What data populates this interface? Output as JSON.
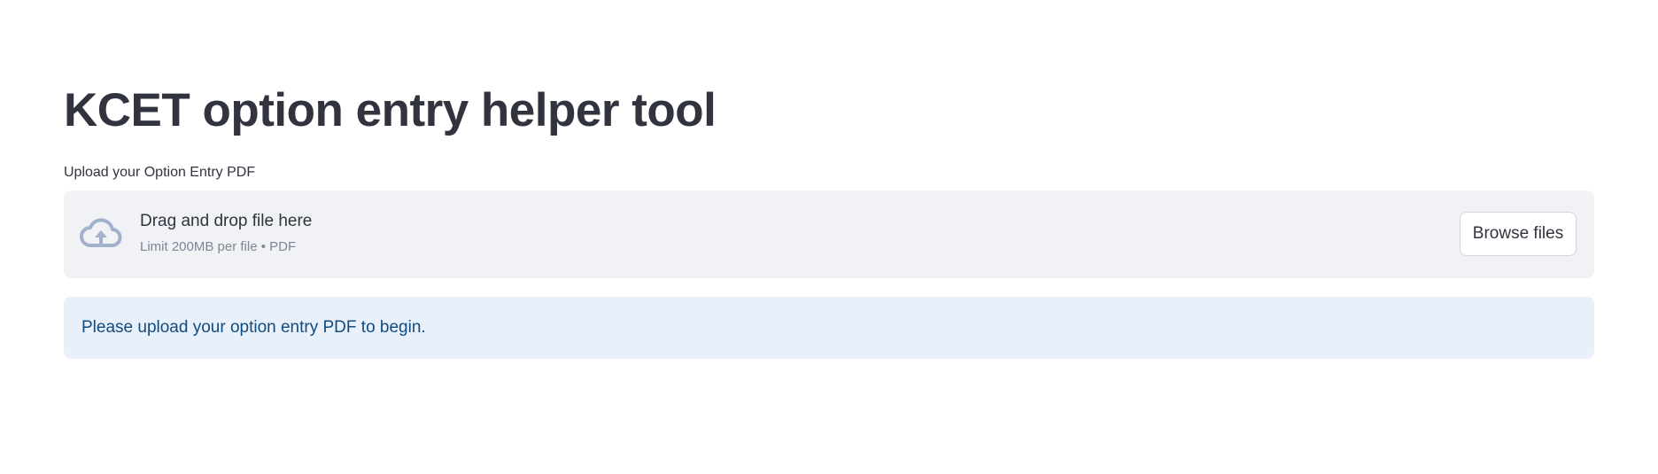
{
  "page": {
    "title": "KCET option entry helper tool"
  },
  "uploader": {
    "label": "Upload your Option Entry PDF",
    "dropzone_instructions": "Drag and drop file here",
    "limit_text": "Limit 200MB per file • PDF",
    "browse_label": "Browse files",
    "icon": "cloud-upload-icon"
  },
  "alert": {
    "message": "Please upload your option entry PDF to begin."
  },
  "colors": {
    "text": "#31333f",
    "dropzone_bg": "#f0f2f6",
    "muted_text": "#808495",
    "icon": "#a3b2cc",
    "info_bg": "#e8f1fb",
    "info_text": "#124a7c"
  }
}
